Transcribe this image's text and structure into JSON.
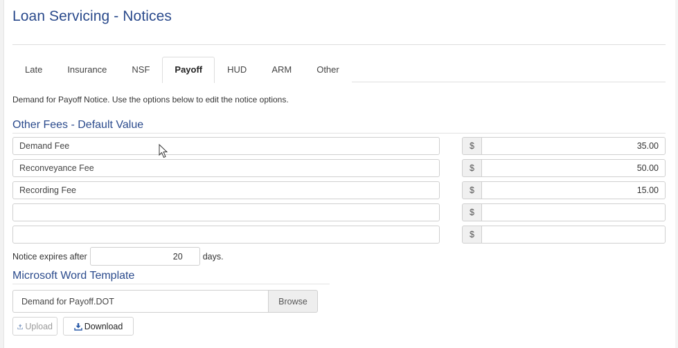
{
  "page": {
    "title": "Loan Servicing - Notices"
  },
  "tabs": [
    {
      "label": "Late",
      "active": false
    },
    {
      "label": "Insurance",
      "active": false
    },
    {
      "label": "NSF",
      "active": false
    },
    {
      "label": "Payoff",
      "active": true
    },
    {
      "label": "HUD",
      "active": false
    },
    {
      "label": "ARM",
      "active": false
    },
    {
      "label": "Other",
      "active": false
    }
  ],
  "payoff": {
    "description": "Demand for Payoff Notice. Use the options below to edit the notice options.",
    "fees_title": "Other Fees - Default Value",
    "currency_symbol": "$",
    "fees": [
      {
        "name": "Demand Fee",
        "amount": "35.00"
      },
      {
        "name": "Reconveyance Fee",
        "amount": "50.00"
      },
      {
        "name": "Recording Fee",
        "amount": "15.00"
      },
      {
        "name": "",
        "amount": ""
      },
      {
        "name": "",
        "amount": ""
      }
    ],
    "expire_prefix": "Notice expires after",
    "expire_days": "20",
    "expire_suffix": "days.",
    "template_title": "Microsoft Word Template",
    "template_file": "Demand for Payoff.DOT",
    "browse_label": "Browse",
    "upload_label": "Upload",
    "download_label": "Download"
  },
  "colors": {
    "heading": "#2a4a8c",
    "border": "#cfcfcf",
    "addon_bg": "#f0f0f0"
  },
  "icons": {
    "upload": "upload-icon",
    "download": "download-icon"
  }
}
